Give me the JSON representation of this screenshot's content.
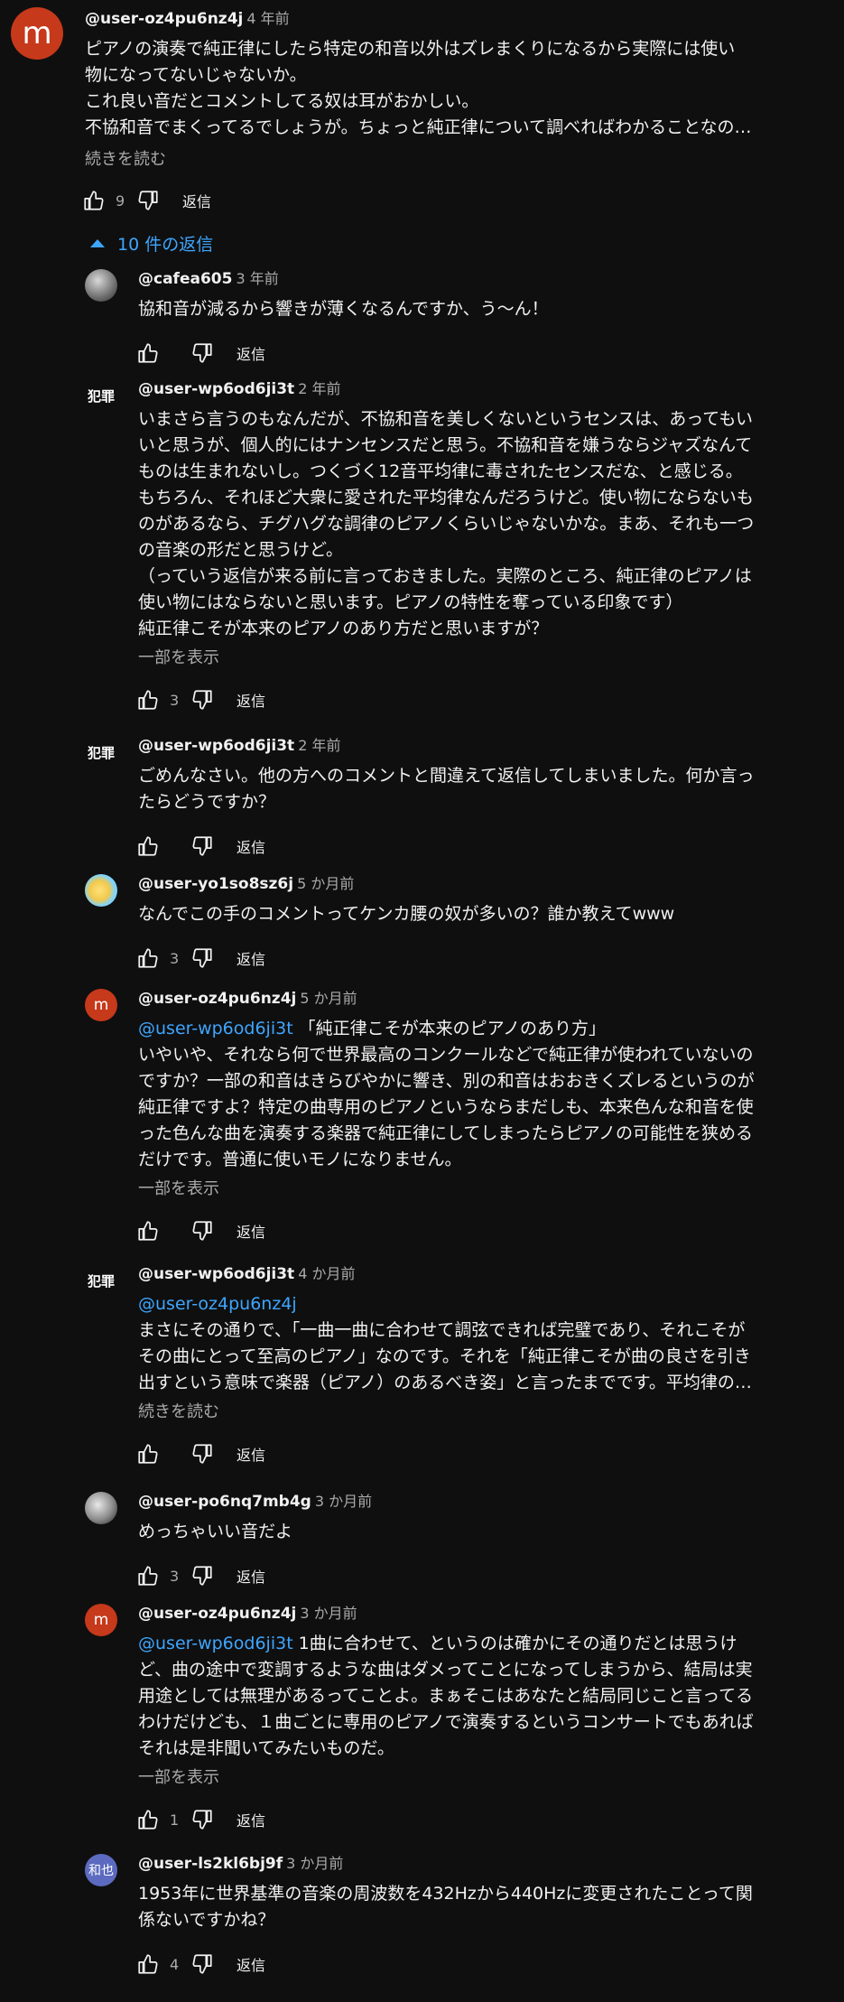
{
  "top_comment": {
    "avatar_letter": "m",
    "author": "@user-oz4pu6nz4j",
    "time": "4 年前",
    "lines": [
      "ピアノの演奏で純正律にしたら特定の和音以外はズレまくりになるから実際には使い",
      "物になってないじゃないか。",
      "これ良い音だとコメントしてる奴は耳がおかしい。",
      "不協和音でまくってるでしょうが。ちょっと純正律について調べればわかることなの…"
    ],
    "more": "続きを読む",
    "likes": "9",
    "reply_label": "返信"
  },
  "replies_toggle": "10 件の返信",
  "replies": [
    {
      "avatar": "grey",
      "avatar_text": "",
      "author": "@cafea605",
      "time": "3 年前",
      "mention": "",
      "lines": [
        "協和音が減るから響きが薄くなるんですか、う〜ん！"
      ],
      "more": "",
      "likes": "",
      "reply_label": "返信"
    },
    {
      "avatar": "hanzai",
      "avatar_text": "犯罪",
      "author": "@user-wp6od6ji3t",
      "time": "2 年前",
      "mention": "",
      "lines": [
        "いまさら言うのもなんだが、不協和音を美しくないというセンスは、あってもい",
        "いと思うが、個人的にはナンセンスだと思う。不協和音を嫌うならジャズなんて",
        "ものは生まれないし。つくづく12音平均律に毒されたセンスだな、と感じる。",
        "もちろん、それほど大衆に愛された平均律なんだろうけど。使い物にならないも",
        "のがあるなら、チグハグな調律のピアノくらいじゃないかな。まあ、それも一つ",
        "の音楽の形だと思うけど。",
        "（っていう返信が来る前に言っておきました。実際のところ、純正律のピアノは",
        "使い物にはならないと思います。ピアノの特性を奪っている印象です）",
        "純正律こそが本来のピアノのあり方だと思いますが？"
      ],
      "more": "一部を表示",
      "likes": "3",
      "reply_label": "返信"
    },
    {
      "avatar": "hanzai",
      "avatar_text": "犯罪",
      "author": "@user-wp6od6ji3t",
      "time": "2 年前",
      "mention": "",
      "lines": [
        "ごめんなさい。他の方へのコメントと間違えて返信してしまいました。何か言っ",
        "たらどうですか？"
      ],
      "more": "",
      "likes": "",
      "reply_label": "返信"
    },
    {
      "avatar": "bird",
      "avatar_text": "",
      "author": "@user-yo1so8sz6j",
      "time": "5 か月前",
      "mention": "",
      "lines": [
        "なんでこの手のコメントってケンカ腰の奴が多いの？誰か教えてwww"
      ],
      "more": "",
      "likes": "3",
      "reply_label": "返信"
    },
    {
      "avatar": "m",
      "avatar_text": "m",
      "author": "@user-oz4pu6nz4j",
      "time": "5 か月前",
      "mention": "@user-wp6od6ji3t",
      "lines": [
        " 「純正律こそが本来のピアノのあり方」",
        "いやいや、それなら何で世界最高のコンクールなどで純正律が使われていないの",
        "ですか？一部の和音はきらびやかに響き、別の和音はおおきくズレるというのが",
        "純正律ですよ？特定の曲専用のピアノというならまだしも、本来色んな和音を使",
        "った色んな曲を演奏する楽器で純正律にしてしまったらピアノの可能性を狭める",
        "だけです。普通に使いモノになりません。"
      ],
      "more": "一部を表示",
      "likes": "",
      "reply_label": "返信"
    },
    {
      "avatar": "hanzai",
      "avatar_text": "犯罪",
      "author": "@user-wp6od6ji3t",
      "time": "4 か月前",
      "mention": "@user-oz4pu6nz4j",
      "lines": [
        "",
        "まさにその通りで、「一曲一曲に合わせて調弦できれば完璧であり、それこそが",
        "その曲にとって至高のピアノ」なのです。それを「純正律こそが曲の良さを引き",
        "出すという意味で楽器（ピアノ）のあるべき姿」と言ったまでです。平均律の…"
      ],
      "more": "続きを読む",
      "likes": "",
      "reply_label": "返信"
    },
    {
      "avatar": "moon",
      "avatar_text": "",
      "author": "@user-po6nq7mb4g",
      "time": "3 か月前",
      "mention": "",
      "lines": [
        "めっちゃいい音だよ"
      ],
      "more": "",
      "likes": "3",
      "reply_label": "返信"
    },
    {
      "avatar": "m",
      "avatar_text": "m",
      "author": "@user-oz4pu6nz4j",
      "time": "3 か月前",
      "mention": "@user-wp6od6ji3t",
      "lines": [
        " 1曲に合わせて、というのは確かにその通りだとは思うけ",
        "ど、曲の途中で変調するような曲はダメってことになってしまうから、結局は実",
        "用途としては無理があるってことよ。まぁそこはあなたと結局同じこと言ってる",
        "わけだけども、１曲ごとに専用のピアノで演奏するというコンサートでもあれば",
        "それは是非聞いてみたいものだ。"
      ],
      "more": "一部を表示",
      "likes": "1",
      "reply_label": "返信"
    },
    {
      "avatar": "kanji",
      "avatar_text": "和也",
      "author": "@user-ls2kl6bj9f",
      "time": "3 か月前",
      "mention": "",
      "lines": [
        "1953年に世界基準の音楽の周波数を432Hzから440Hzに変更されたことって関",
        "係ないですかね？"
      ],
      "more": "",
      "likes": "4",
      "reply_label": "返信"
    }
  ]
}
